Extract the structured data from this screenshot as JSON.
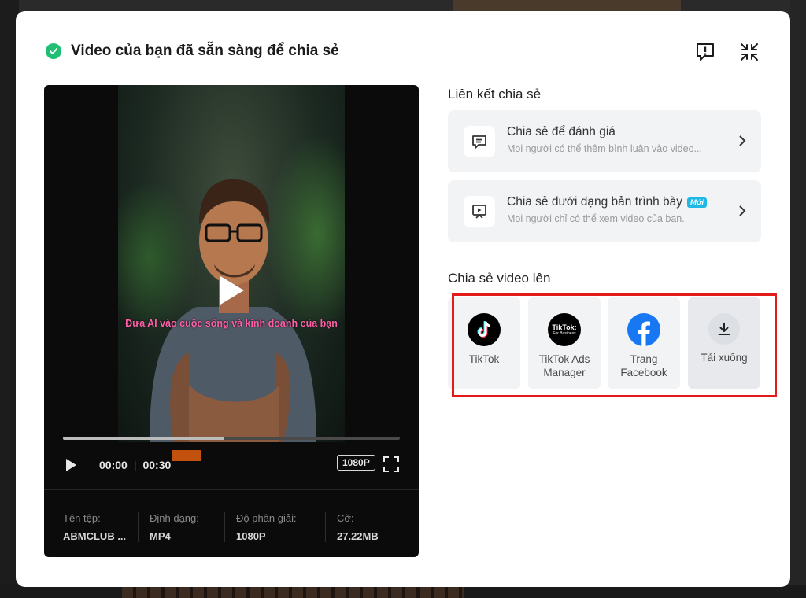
{
  "header": {
    "title": "Video của bạn đã sẵn sàng để chia sẻ",
    "success_color": "#1fbf74"
  },
  "player": {
    "caption": "Đưa AI vào cuộc sống và kinh doanh của bạn",
    "current_time": "00:00",
    "duration": "00:30",
    "quality": "1080P",
    "progress_fraction": 0.48,
    "file_info": {
      "name_label": "Tên tệp:",
      "name_value": "ABMCLUB ...",
      "format_label": "Định dạng:",
      "format_value": "MP4",
      "resolution_label": "Độ phân giải:",
      "resolution_value": "1080P",
      "size_label": "Cỡ:",
      "size_value": "27.22MB"
    }
  },
  "share_links": {
    "title": "Liên kết chia sẻ",
    "items": [
      {
        "title": "Chia sẻ để đánh giá",
        "subtitle": "Mọi người có thể thêm bình luận vào video...",
        "icon": "comment-icon"
      },
      {
        "title": "Chia sẻ dưới dạng bản trình bày",
        "badge": "Mới",
        "subtitle": "Mọi người chỉ có thể xem video của bạn.",
        "icon": "presentation-icon"
      }
    ]
  },
  "share_to": {
    "title": "Chia sẻ video lên",
    "highlight_color": "#e21b1b",
    "tiles": [
      {
        "label": "TikTok",
        "icon": "tiktok-icon"
      },
      {
        "label_line1": "TikTok Ads",
        "label_line2": "Manager",
        "logo_text": "TikTok:",
        "logo_subtext": "For Business",
        "icon": "tiktok-business-icon"
      },
      {
        "label_line1": "Trang",
        "label_line2": "Facebook",
        "icon": "facebook-icon",
        "color": "#1877f2"
      },
      {
        "label": "Tải xuống",
        "icon": "download-icon"
      }
    ]
  }
}
